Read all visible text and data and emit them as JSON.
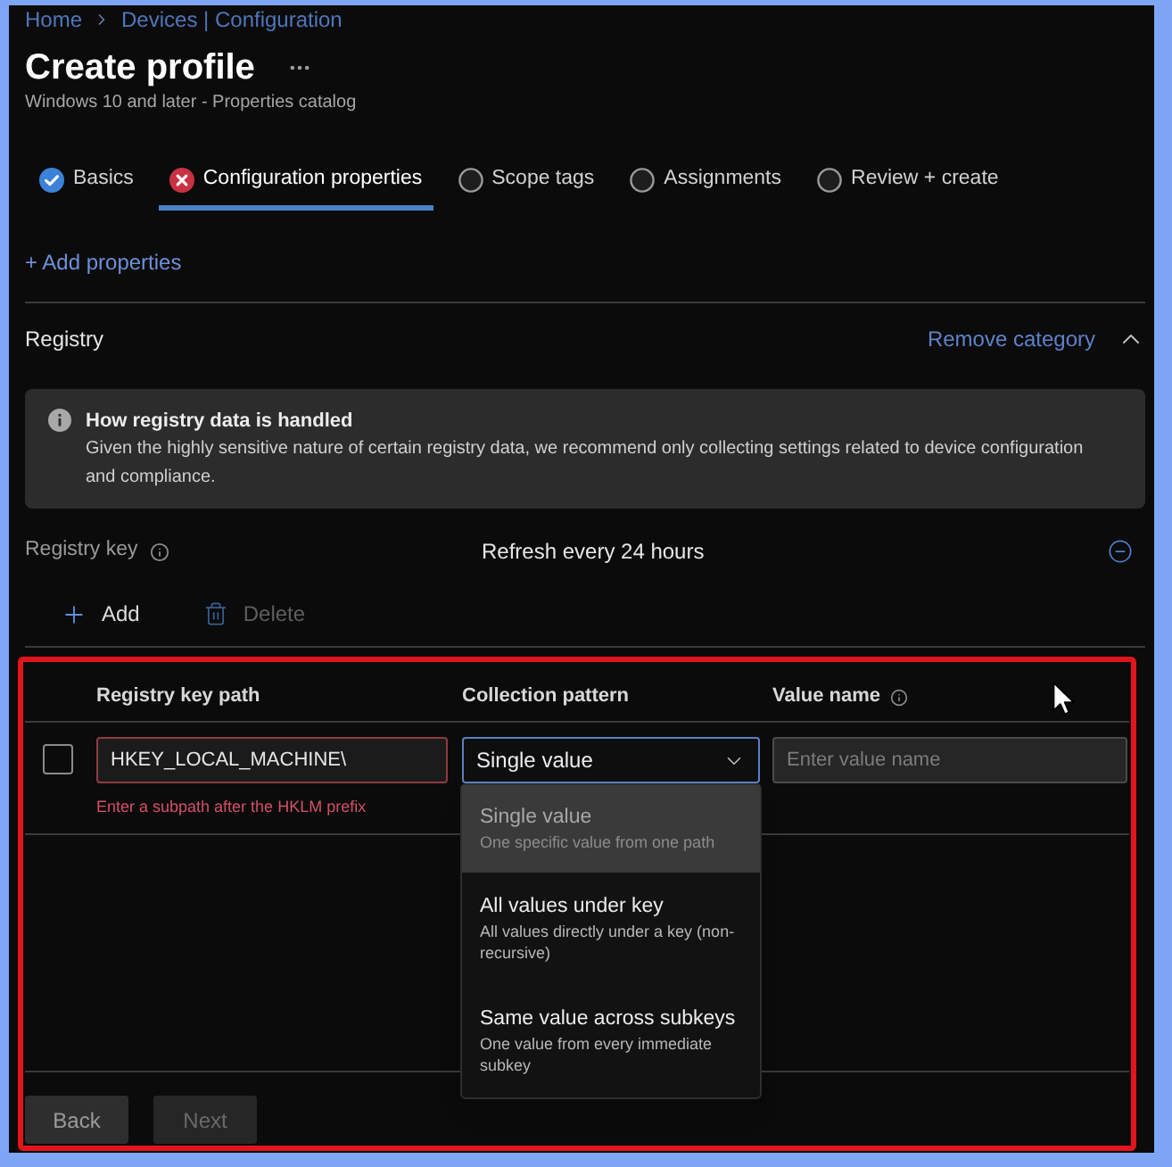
{
  "breadcrumb": [
    "Home",
    "Devices | Configuration"
  ],
  "header": {
    "title": "Create profile",
    "subtitle": "Windows 10 and later - Properties catalog"
  },
  "tabs": [
    {
      "label": "Basics",
      "kind": "complete",
      "selected": false
    },
    {
      "label": "Configuration properties",
      "kind": "error",
      "selected": true
    },
    {
      "label": "Scope tags",
      "kind": "pending",
      "selected": false
    },
    {
      "label": "Assignments",
      "kind": "pending",
      "selected": false
    },
    {
      "label": "Review + create",
      "kind": "pending",
      "selected": false
    }
  ],
  "add_properties": "+ Add properties",
  "category": {
    "title": "Registry",
    "remove_label": "Remove category",
    "expanded": true
  },
  "info_box": {
    "title": "How registry data is handled",
    "body": "Given the highly sensitive nature of certain registry data, we recommend only collecting settings related to device configuration and compliance."
  },
  "setting": {
    "label": "Registry key",
    "info": true,
    "value": "Refresh every 24 hours"
  },
  "toolbar": [
    {
      "kind": "add",
      "label": "Add",
      "disabled": false
    },
    {
      "kind": "delete",
      "label": "Delete",
      "disabled": true
    }
  ],
  "table": {
    "columns": [
      {
        "label": "Registry key path"
      },
      {
        "label": "Collection pattern"
      },
      {
        "label": "Value name",
        "info": true
      }
    ],
    "rows": [
      {
        "checked": false,
        "key_path": {
          "value": "HKEY_LOCAL_MACHINE\\",
          "error": "Enter a subpath after the HKLM prefix"
        },
        "collection_pattern": {
          "value": "Single value",
          "open": true,
          "options": [
            {
              "label": "Single value",
              "description": "One specific value from one path",
              "selected": true
            },
            {
              "label": "All values under key",
              "description": "All values directly under a key (non-recursive)",
              "selected": false
            },
            {
              "label": "Same value across subkeys",
              "description": "One value from every immediate subkey",
              "selected": false
            }
          ]
        },
        "value_name": {
          "placeholder": "Enter value name"
        }
      }
    ]
  },
  "footer_buttons": [
    {
      "label": "Back",
      "disabled": false
    },
    {
      "label": "Next",
      "disabled": true
    }
  ]
}
